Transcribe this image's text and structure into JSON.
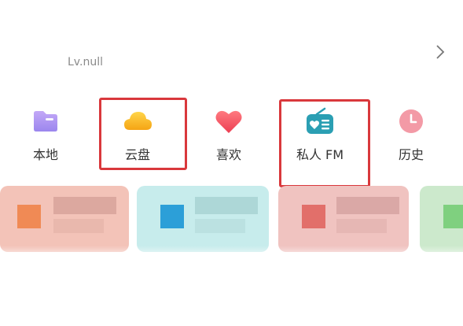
{
  "profile": {
    "level": "Lv.null"
  },
  "shortcuts": [
    {
      "label": "本地",
      "icon": "folder-icon"
    },
    {
      "label": "云盘",
      "icon": "cloud-icon"
    },
    {
      "label": "喜欢",
      "icon": "heart-icon"
    },
    {
      "label": "私人 FM",
      "icon": "radio-icon"
    },
    {
      "label": "历史",
      "icon": "clock-icon"
    }
  ],
  "colors": {
    "highlight": "#d9383c",
    "folder": "#a98ef0",
    "cloud": "#f5b21e",
    "heart": "#f0505e",
    "radio": "#2b9fb3",
    "clock": "#f39aa6"
  }
}
